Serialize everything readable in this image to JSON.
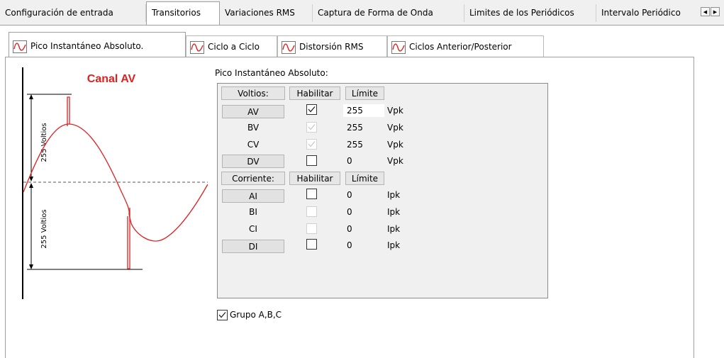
{
  "top_tabs": [
    {
      "label": "Configuración de entrada",
      "active": false
    },
    {
      "label": "Transitorios",
      "active": true
    },
    {
      "label": "Variaciones RMS",
      "active": false
    },
    {
      "label": "Captura de Forma de Onda",
      "active": false
    },
    {
      "label": "Limites de los Periódicos",
      "active": false
    },
    {
      "label": "Intervalo Periódico",
      "active": false
    }
  ],
  "sub_tabs": [
    {
      "label": "Pico Instantáneo Absoluto.",
      "active": true,
      "icon": "waveform-icon"
    },
    {
      "label": "Ciclo a Ciclo",
      "active": false,
      "icon": "waveform-icon"
    },
    {
      "label": "Distorsión RMS",
      "active": false,
      "icon": "waveform-icon"
    },
    {
      "label": "Ciclos Anterior/Posterior",
      "active": false,
      "icon": "waveform-icon"
    }
  ],
  "diagram": {
    "title": "Canal AV",
    "upper_label": "255 Voltios",
    "lower_label": "255 Voltios",
    "title_color": "#e02020",
    "wave_color": "#e02020"
  },
  "settings": {
    "section_label": "Pico Instantáneo Absoluto:",
    "voltage_header": {
      "name": "Voltios:",
      "enable": "Habilitar",
      "limit": "Límite"
    },
    "voltage_rows": [
      {
        "name": "AV",
        "checked": true,
        "enabled": true,
        "value": "255",
        "unit": "Vpk",
        "button": true
      },
      {
        "name": "BV",
        "checked": true,
        "enabled": false,
        "value": "255",
        "unit": "Vpk",
        "button": false
      },
      {
        "name": "CV",
        "checked": true,
        "enabled": false,
        "value": "255",
        "unit": "Vpk",
        "button": false
      },
      {
        "name": "DV",
        "checked": false,
        "enabled": true,
        "value": "0",
        "unit": "Vpk",
        "button": true
      }
    ],
    "current_header": {
      "name": "Corriente:",
      "enable": "Habilitar",
      "limit": "Límite"
    },
    "current_rows": [
      {
        "name": "AI",
        "checked": false,
        "enabled": true,
        "value": "0",
        "unit": "Ipk",
        "button": true
      },
      {
        "name": "BI",
        "checked": false,
        "enabled": false,
        "value": "0",
        "unit": "Ipk",
        "button": false
      },
      {
        "name": "CI",
        "checked": false,
        "enabled": false,
        "value": "0",
        "unit": "Ipk",
        "button": false
      },
      {
        "name": "DI",
        "checked": false,
        "enabled": true,
        "value": "0",
        "unit": "Ipk",
        "button": true
      }
    ],
    "group_label": "Grupo A,B,C",
    "group_checked": true
  }
}
